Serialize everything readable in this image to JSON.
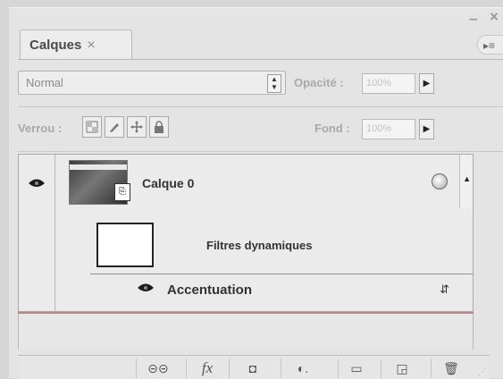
{
  "panel": {
    "tab_label": "Calques",
    "tab_close": "×",
    "window_min": "–",
    "window_close": "×",
    "menu_glyph": "▸≡"
  },
  "blend": {
    "mode": "Normal",
    "opacity_label": "Opacité :",
    "opacity_value": "100%"
  },
  "lock": {
    "label": "Verrou :",
    "fill_label": "Fond :",
    "fill_value": "100%"
  },
  "layers": [
    {
      "name": "Calque 0"
    },
    {
      "name": "Filtres dynamiques"
    },
    {
      "name": "Accentuation"
    }
  ],
  "toolbar_icons": [
    "link-icon",
    "fx-icon",
    "mask-icon",
    "adjustment-icon",
    "folder-icon",
    "new-layer-icon",
    "trash-icon"
  ],
  "toolbar_glyphs": [
    "⊝⊝",
    "fx",
    "◘",
    "◐.",
    "▭",
    "◲",
    "🗑"
  ]
}
